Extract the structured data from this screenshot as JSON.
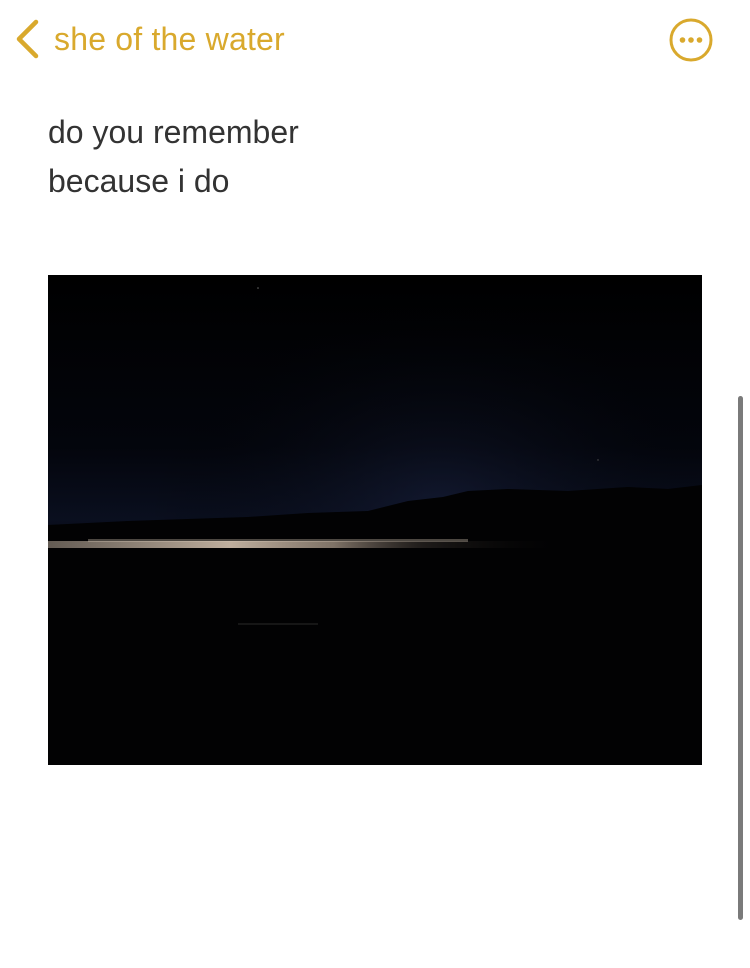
{
  "nav": {
    "back_label": "she of the water",
    "back_icon": "chevron-left-icon",
    "more_icon": "ellipsis-circle-icon",
    "accent_color": "#d9a92d"
  },
  "note": {
    "lines": [
      "do you remember",
      "because i do"
    ],
    "text_color": "#333333"
  },
  "attachment": {
    "kind": "photo",
    "subject": "night-lake"
  }
}
